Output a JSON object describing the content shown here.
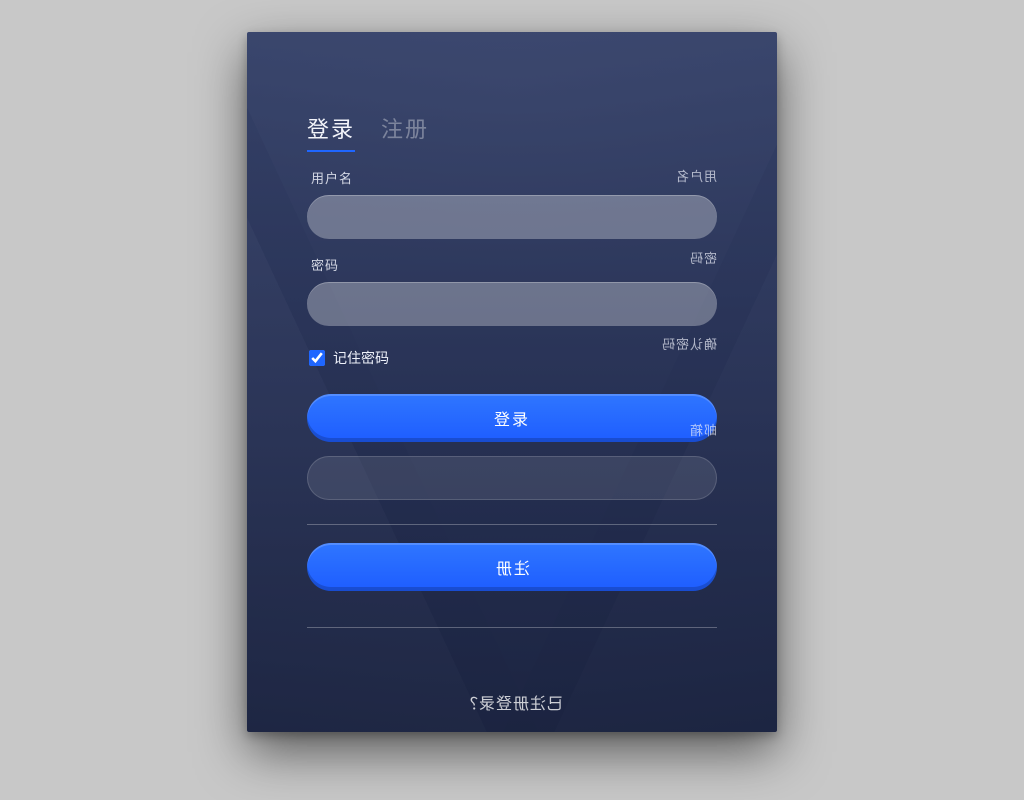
{
  "tabs": {
    "login": "登录",
    "register": "注册"
  },
  "login": {
    "username_label": "用户名",
    "password_label": "密码",
    "remember_label": "记住密码",
    "submit_label": "登录",
    "checked": true
  },
  "register_mirrored": {
    "field1_label": "用户名",
    "field2_label": "密码",
    "field3_label": "确认密码",
    "field4_label": "邮箱",
    "submit_label": "注册"
  },
  "swap_link": "已注册登录？"
}
